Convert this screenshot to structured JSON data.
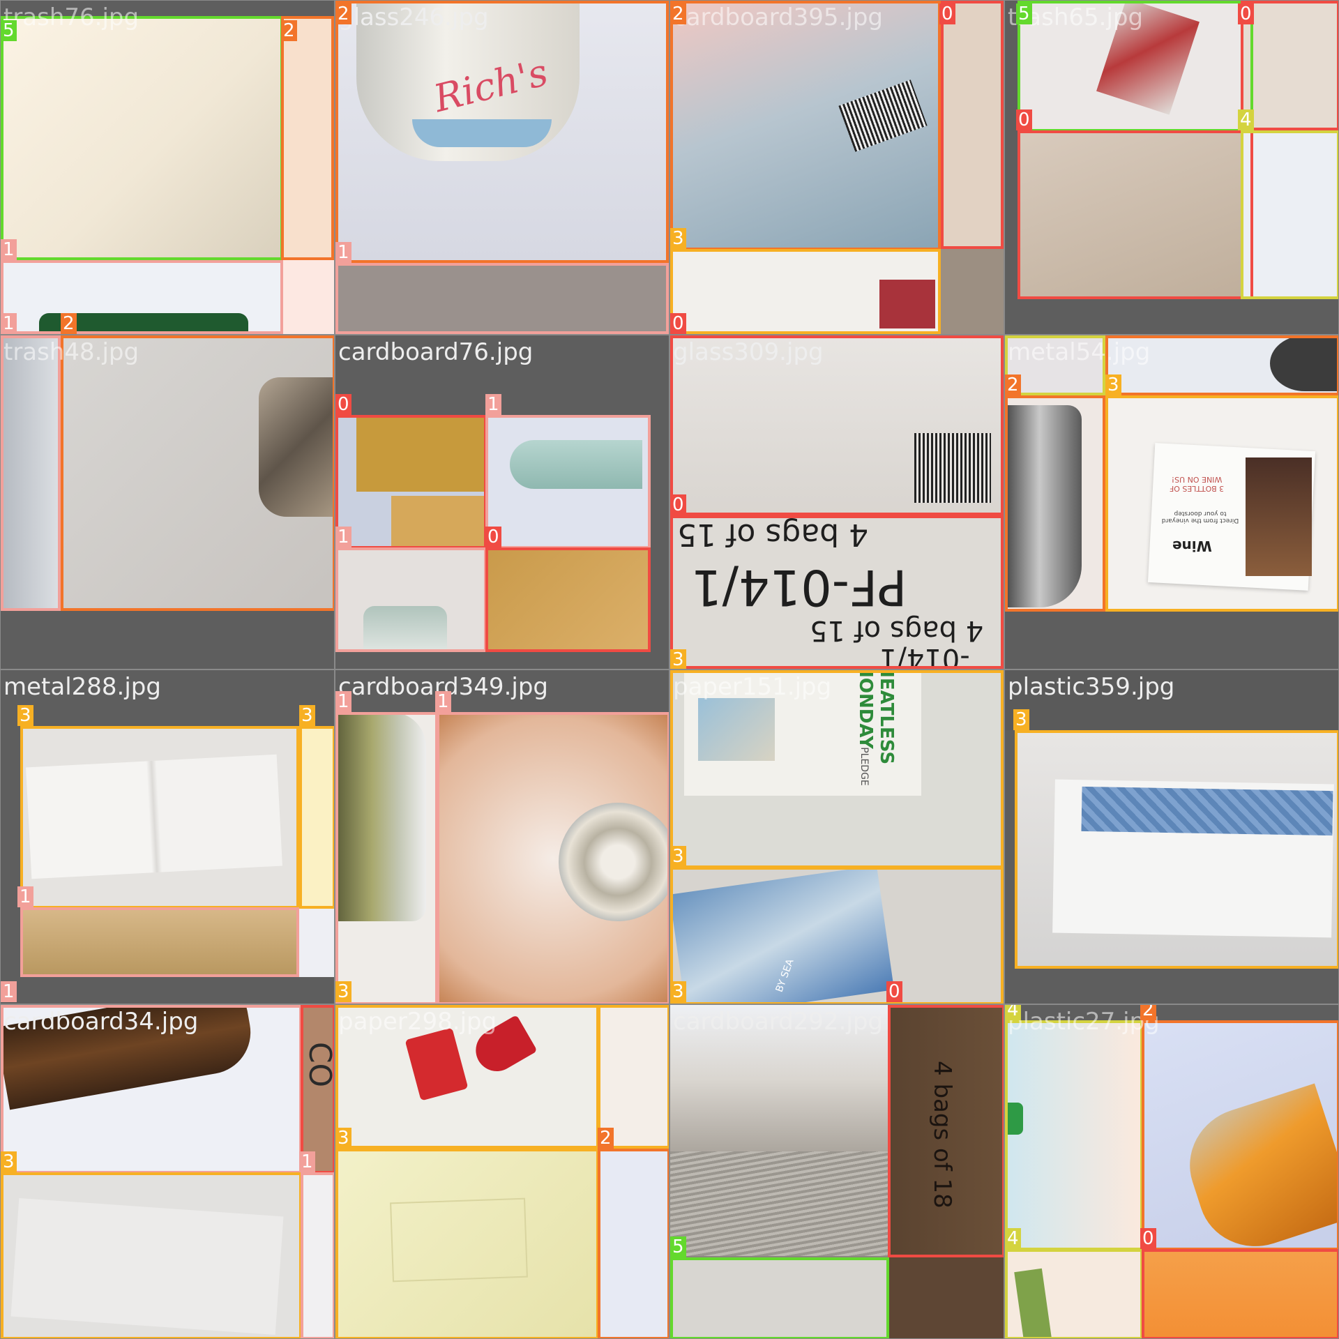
{
  "colors": {
    "0": "#f04b43",
    "1": "#f2a09a",
    "2": "#f2742a",
    "3": "#f7b023",
    "4": "#d4d33f",
    "5": "#63d92d"
  },
  "tiles": [
    {
      "name": "trash76.jpg",
      "faint": true,
      "labels": [
        "5",
        "2",
        "1",
        "1",
        "2"
      ]
    },
    {
      "name": "glass246.jpg",
      "faint": false,
      "labels": [
        "2",
        "1"
      ]
    },
    {
      "name": "cardboard395.jpg",
      "faint": true,
      "labels": [
        "2",
        "0",
        "3",
        "0"
      ]
    },
    {
      "name": "trash65.jpg",
      "faint": true,
      "labels": [
        "5",
        "0",
        "0",
        "4"
      ]
    },
    {
      "name": "trash48.jpg",
      "faint": true,
      "labels": [
        "2"
      ]
    },
    {
      "name": "cardboard76.jpg",
      "faint": false,
      "labels": [
        "0",
        "1",
        "1",
        "0"
      ]
    },
    {
      "name": "glass309.jpg",
      "faint": false,
      "labels": [
        "0",
        "3"
      ]
    },
    {
      "name": "metal54.jpg",
      "faint": true,
      "labels": [
        "4",
        "2",
        "2",
        "3"
      ]
    },
    {
      "name": "metal288.jpg",
      "faint": false,
      "labels": [
        "3",
        "3",
        "1",
        "1"
      ]
    },
    {
      "name": "cardboard349.jpg",
      "faint": false,
      "labels": [
        "1",
        "1",
        "3"
      ]
    },
    {
      "name": "paper151.jpg",
      "faint": true,
      "labels": [
        "3",
        "3",
        "0"
      ]
    },
    {
      "name": "plastic359.jpg",
      "faint": false,
      "labels": [
        "3"
      ]
    },
    {
      "name": "cardboard34.jpg",
      "faint": false,
      "labels": [
        "0",
        "3",
        "1"
      ]
    },
    {
      "name": "paper298.jpg",
      "faint": true,
      "labels": [
        "3",
        "3",
        "2"
      ]
    },
    {
      "name": "cardboard292.jpg",
      "faint": false,
      "labels": [
        "0",
        "5"
      ]
    },
    {
      "name": "plastic27.jpg",
      "faint": true,
      "labels": [
        "4",
        "2",
        "4",
        "0"
      ]
    }
  ],
  "photo_text": {
    "can_brand": "Rich's",
    "box_line_1": "4 bags of 15",
    "box_line_2": "PF-014/1",
    "box_line_3": "4 bags of 15",
    "box_line_4": "-014/1",
    "magazine_1": "MEATLESS MONDAY",
    "magazine_2": "PLEDGE",
    "wine_card_1": "Wine",
    "wine_card_2": "3 BOTTLES OF WINE ON US!",
    "wine_card_3": "Direct from the vineyard to your doorstep",
    "sea_card": "BY SEA",
    "bag_text": "4 bags of 18",
    "cardboard_letters": "CO"
  }
}
